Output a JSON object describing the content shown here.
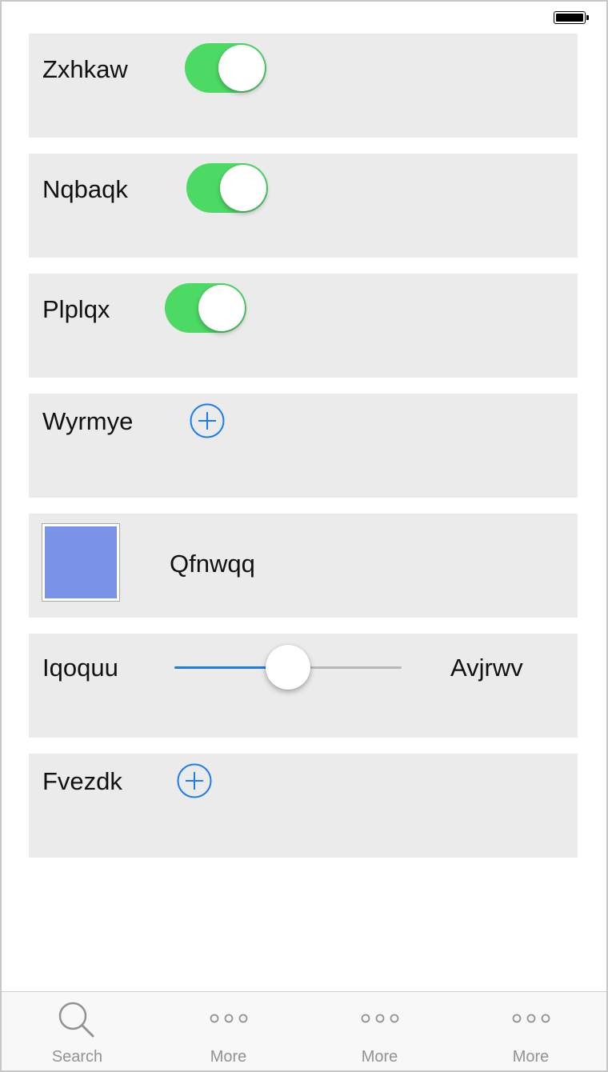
{
  "status_bar": {
    "battery_icon": "battery-full-icon"
  },
  "rows": {
    "zxhkaw": {
      "label": "Zxhkaw",
      "switch_on": true
    },
    "nqbaqk": {
      "label": "Nqbaqk",
      "switch_on": true
    },
    "plplqx": {
      "label": "Plplqx",
      "switch_on": true
    },
    "wyrmye": {
      "label": "Wyrmye",
      "icon": "add-circle-icon"
    },
    "qfnwqq": {
      "label": "Qfnwqq",
      "swatch_color": "#7b93e6"
    },
    "slider": {
      "min_label": "Iqoquu",
      "max_label": "Avjrwv",
      "value": 0.5
    },
    "fvezdk": {
      "label": "Fvezdk",
      "icon": "add-circle-icon"
    }
  },
  "tabbar": {
    "tabs": [
      {
        "label": "Search",
        "icon": "search-icon"
      },
      {
        "label": "More",
        "icon": "more-icon"
      },
      {
        "label": "More",
        "icon": "more-icon"
      },
      {
        "label": "More",
        "icon": "more-icon"
      }
    ]
  },
  "colors": {
    "switch_on": "#4cd964",
    "accent": "#1a7cf0",
    "cell_background": "#ebebeb",
    "tab_inactive": "#929292"
  }
}
